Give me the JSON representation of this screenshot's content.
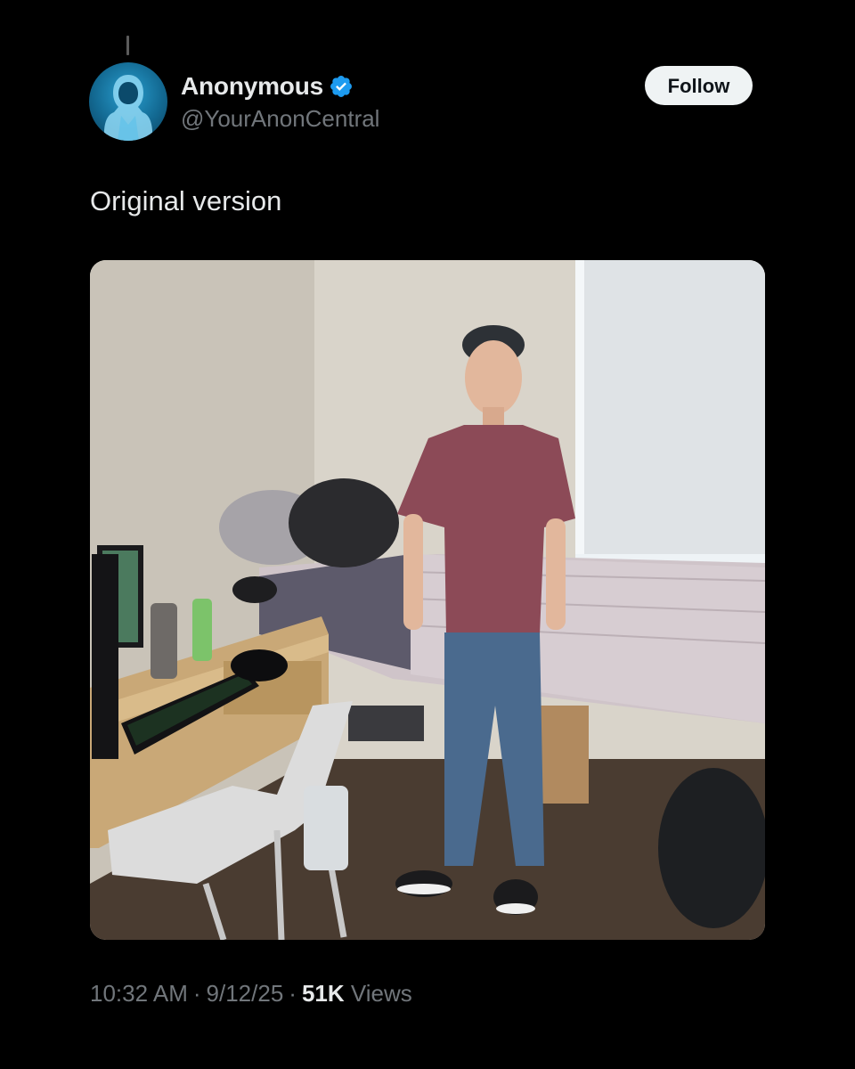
{
  "tweet": {
    "author": {
      "display_name": "Anonymous",
      "handle": "@YourAnonCentral",
      "verified_icon": "verified-badge-icon",
      "avatar_icon": "hooded-figure-avatar"
    },
    "follow_label": "Follow",
    "text": "Original version",
    "media": {
      "image_description_icon": "dorm-room-photo"
    },
    "meta": {
      "time": "10:32 AM",
      "date": "9/12/25",
      "separator": "·",
      "views_count": "51K",
      "views_label": "Views"
    }
  },
  "colors": {
    "background": "#000000",
    "text_primary": "#e7e9ea",
    "text_secondary": "#71767b",
    "verified_blue": "#1d9bf0",
    "follow_bg": "#eff3f4"
  }
}
